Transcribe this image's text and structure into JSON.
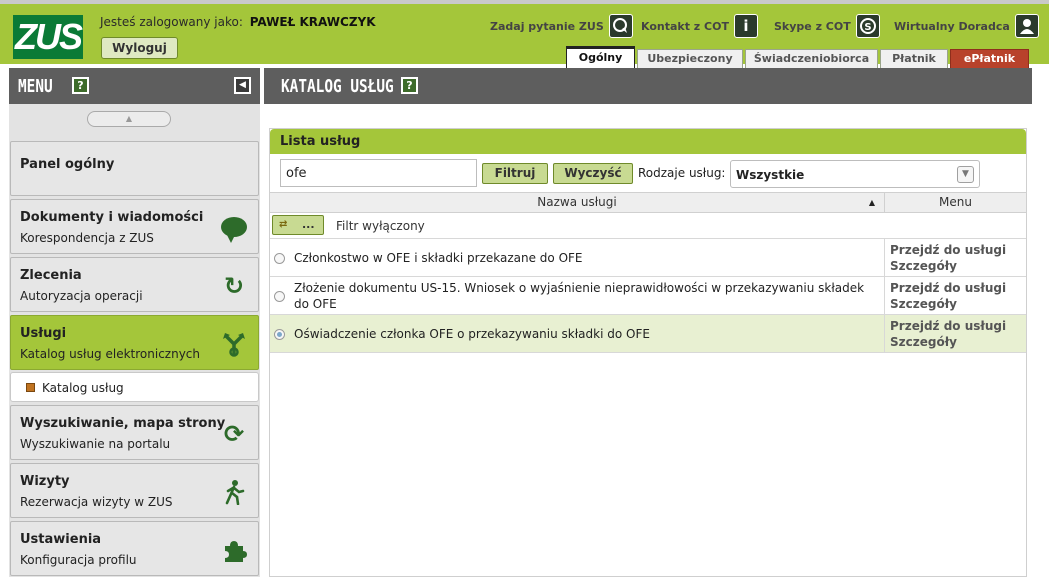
{
  "header": {
    "logo_text": "ZUS",
    "logged_in_prefix": "Jesteś zalogowany jako:",
    "user_name": "PAWEŁ KRAWCZYK",
    "logout_label": "Wyloguj",
    "links": [
      {
        "label": "Zadaj pytanie ZUS",
        "icon": "chat-question-icon"
      },
      {
        "label": "Kontakt z COT",
        "icon": "info-icon"
      },
      {
        "label": "Skype z COT",
        "icon": "skype-icon"
      },
      {
        "label": "Wirtualny Doradca",
        "icon": "person-icon"
      }
    ],
    "tabs": [
      {
        "label": "Ogólny",
        "active": true
      },
      {
        "label": "Ubezpieczony",
        "active": false
      },
      {
        "label": "Świadczeniobiorca",
        "active": false
      },
      {
        "label": "Płatnik",
        "active": false
      },
      {
        "label": "ePłatnik",
        "active": false
      }
    ]
  },
  "sidebar": {
    "title": "MENU",
    "help": "?",
    "items": [
      {
        "title": "Panel ogólny",
        "subtitle": "",
        "icon": ""
      },
      {
        "title": "Dokumenty i wiadomości",
        "subtitle": "Korespondencja z ZUS",
        "icon": "speech-bubble-icon"
      },
      {
        "title": "Zlecenia",
        "subtitle": "Autoryzacja operacji",
        "icon": "refresh-icon"
      },
      {
        "title": "Usługi",
        "subtitle": "Katalog usług elektronicznych",
        "icon": "branch-arrows-icon"
      },
      {
        "title": "Wyszukiwanie, mapa strony",
        "subtitle": "Wyszukiwanie na portalu",
        "icon": "sync-icon"
      },
      {
        "title": "Wizyty",
        "subtitle": "Rezerwacja wizyty w ZUS",
        "icon": "walking-person-icon"
      },
      {
        "title": "Ustawienia",
        "subtitle": "Konfiguracja profilu",
        "icon": "puzzle-icon"
      }
    ],
    "submenu_label": "Katalog usług"
  },
  "main": {
    "title": "KATALOG USŁUG",
    "help": "?",
    "panel_title": "Lista usług",
    "search_value": "ofe",
    "filter_button": "Filtruj",
    "clear_button": "Wyczyść",
    "kinds_label": "Rodzaje usług:",
    "kinds_value": "Wszystkie",
    "col_name": "Nazwa usługi",
    "col_menu": "Menu",
    "filter_toggle_label": "...",
    "filter_state": "Filtr wyłączony",
    "rows": [
      {
        "name": "Członkostwo w OFE i składki przekazane do OFE",
        "link1": "Przejdź do usługi",
        "link2": "Szczegóły",
        "selected": false
      },
      {
        "name": "Złożenie dokumentu US-15. Wniosek o wyjaśnienie nieprawidłowości w przekazywaniu składek do OFE",
        "link1": "Przejdź do usługi",
        "link2": "Szczegóły",
        "selected": false
      },
      {
        "name": "Oświadczenie członka OFE o przekazywaniu składki do OFE",
        "link1": "Przejdź do usługi",
        "link2": "Szczegóły",
        "selected": true
      }
    ]
  },
  "colors": {
    "brand_green": "#a4c63a",
    "dark_green": "#0a7a36",
    "header_grey": "#5e5e5e",
    "eplatnik_red": "#b8422b",
    "selected_row": "#e8f0d2"
  }
}
